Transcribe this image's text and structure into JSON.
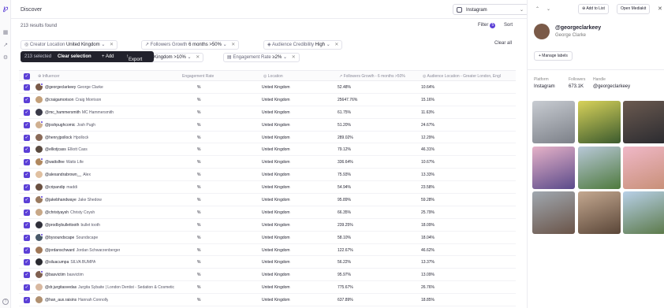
{
  "header": {
    "title": "Discover",
    "platform": "Instagram",
    "results": "213 results found",
    "filter_label": "Filter",
    "filter_count": "5",
    "sort_label": "Sort",
    "clear_all": "Clear all"
  },
  "filters": [
    {
      "label": "Creator Location",
      "value": "United Kingdom"
    },
    {
      "label": "Followers Growth",
      "value": "6 months >50%"
    },
    {
      "label": "Audience Credibility",
      "value": "High"
    },
    {
      "label": "",
      "value": "Kingdom >10%"
    },
    {
      "label": "Engagement Rate",
      "value": "≥2%"
    }
  ],
  "selection": {
    "count_text": "213 selected",
    "clear": "Clear selection",
    "add": "+ Add",
    "export": "Export"
  },
  "columns": [
    "Influencer",
    "Engagement Rate",
    "Location",
    "Followers Growth - 6 months >50%",
    "Audience Location - Greater London, Engl"
  ],
  "rows": [
    {
      "handle": "@georgeclarkeey",
      "name": "George Clarke",
      "er": "%",
      "loc": "United Kingdom",
      "growth": "52.48%",
      "aud": "10.64%"
    },
    {
      "handle": "@craigamorison",
      "name": "Craig Morrison",
      "er": "%",
      "loc": "United Kingdom",
      "growth": "25647.76%",
      "aud": "15.16%"
    },
    {
      "handle": "@mc_hammersmith",
      "name": "MC Hammersmith",
      "er": "%",
      "loc": "United Kingdom",
      "growth": "61.75%",
      "aud": "11.63%"
    },
    {
      "handle": "@joshpughcomic",
      "name": "Josh Pugh",
      "er": "%",
      "loc": "United Kingdom",
      "growth": "51.20%",
      "aud": "24.67%"
    },
    {
      "handle": "@henryjpollock",
      "name": "Hpollock",
      "er": "%",
      "loc": "United Kingdom",
      "growth": "289.02%",
      "aud": "12.29%"
    },
    {
      "handle": "@elliotjcass",
      "name": "Elliott Cass",
      "er": "%",
      "loc": "United Kingdom",
      "growth": "79.12%",
      "aud": "46.31%"
    },
    {
      "handle": "@wattslfee",
      "name": "Watts Life",
      "er": "%",
      "loc": "United Kingdom",
      "growth": "336.64%",
      "aud": "10.67%"
    },
    {
      "handle": "@alexandrabrown__",
      "name": "Alex",
      "er": "%",
      "loc": "United Kingdom",
      "growth": "75.93%",
      "aud": "13.33%"
    },
    {
      "handle": "@cripandip",
      "name": "maddi",
      "er": "%",
      "loc": "United Kingdom",
      "growth": "54.94%",
      "aud": "23.58%"
    },
    {
      "handle": "@jakebhandwaye",
      "name": "Jake Shedow",
      "er": "%",
      "loc": "United Kingdom",
      "growth": "95.89%",
      "aud": "59.28%"
    },
    {
      "handle": "@christyaysh",
      "name": "Christy Coysh",
      "er": "%",
      "loc": "United Kingdom",
      "growth": "66.35%",
      "aud": "25.79%"
    },
    {
      "handle": "@prodbybullettooth",
      "name": "bullet tooth",
      "er": "%",
      "loc": "United Kingdom",
      "growth": "239.25%",
      "aud": "18.09%"
    },
    {
      "handle": "@bysoundscape",
      "name": "Soundscape",
      "er": "%",
      "loc": "United Kingdom",
      "growth": "58.10%",
      "aud": "18.04%"
    },
    {
      "handle": "@jordanschward",
      "name": "Jordan Schwarzenberger",
      "er": "%",
      "loc": "United Kingdom",
      "growth": "122.67%",
      "aud": "46.62%"
    },
    {
      "handle": "@siluacumpa",
      "name": "SILVA BUMPA",
      "er": "%",
      "loc": "United Kingdom",
      "growth": "56.22%",
      "aud": "13.37%"
    },
    {
      "handle": "@basvictim",
      "name": "basvictim",
      "er": "%",
      "loc": "United Kingdom",
      "growth": "95.97%",
      "aud": "13.09%"
    },
    {
      "handle": "@dr.jurgitasvedas",
      "name": "Jurgita Sybaite | London Dentist - Sedation & Cosmetic",
      "er": "%",
      "loc": "United Kingdom",
      "growth": "775.67%",
      "aud": "26.76%"
    },
    {
      "handle": "@han_aux.raisins",
      "name": "Hannah Connolly",
      "er": "%",
      "loc": "United Kingdom",
      "growth": "637.89%",
      "aud": "18.85%"
    }
  ],
  "panel": {
    "add_to_list": "Add to List",
    "open_mediakit": "Open Mediakit",
    "handle": "@georgeclarkeey",
    "name": "George Clarke",
    "manage_labels": "+ Manage labels",
    "platform_label": "Platform",
    "platform_value": "Instagram",
    "followers_label": "Followers",
    "followers_value": "673.1K",
    "handle_label": "Handle",
    "handle_value": "@georgeclarkeey"
  },
  "colors": {
    "accent": "#5b3fd6",
    "selbar": "#22222c"
  }
}
